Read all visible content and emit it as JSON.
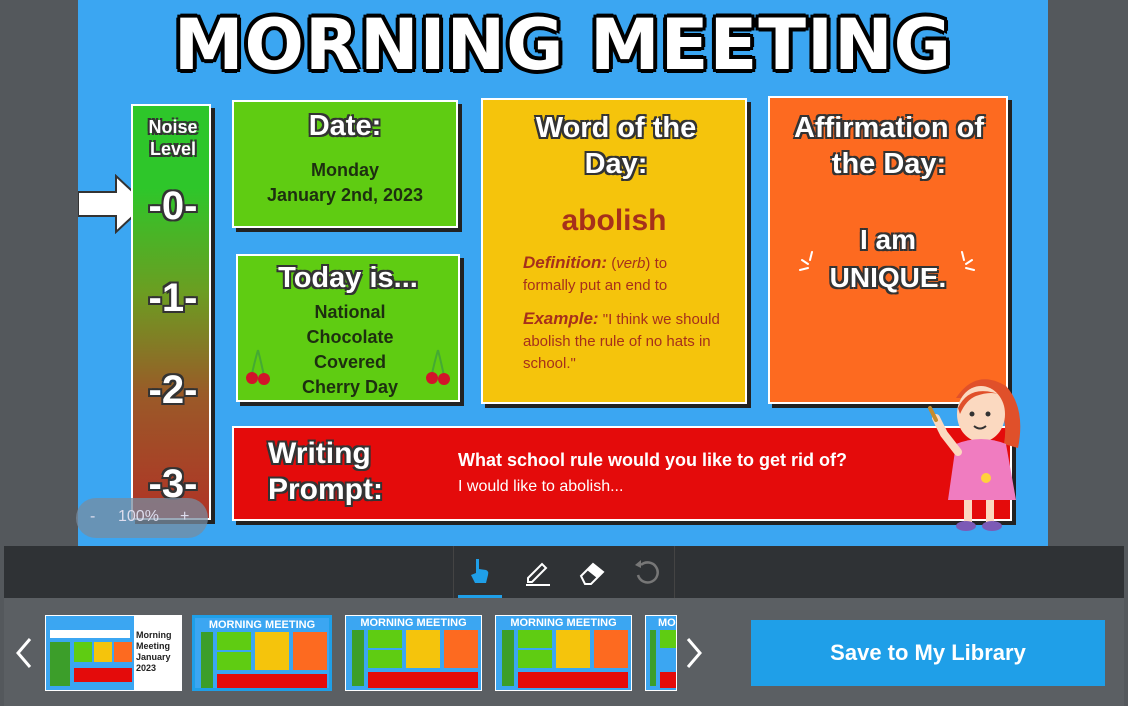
{
  "slide": {
    "title": "MORNING MEETING",
    "noise": {
      "label": "Noise Level",
      "levels": [
        "-0-",
        "-1-",
        "-2-",
        "-3-"
      ]
    },
    "date": {
      "title": "Date:",
      "day": "Monday",
      "full": "January 2nd, 2023"
    },
    "today": {
      "title": "Today is...",
      "text": "National Chocolate Covered Cherry Day"
    },
    "word": {
      "title": "Word of the Day:",
      "word": "abolish",
      "definition_label": "Definition:",
      "definition_pos": "verb",
      "definition": "to formally put an end to",
      "example_label": "Example:",
      "example": "\"I think we should abolish the rule of no hats in school.\""
    },
    "affirmation": {
      "title": "Affirmation of the Day:",
      "line1": "I am",
      "line2": "UNIQUE."
    },
    "writing": {
      "title_line1": "Writing",
      "title_line2": "Prompt:",
      "question": "What school rule would you like to get rid of?",
      "starter": "I would like to abolish..."
    }
  },
  "zoom": {
    "minus": "-",
    "level": "100%",
    "plus": "+"
  },
  "tools": {
    "icons": [
      "pointer-hand-icon",
      "pen-icon",
      "eraser-icon",
      "undo-icon"
    ]
  },
  "thumbnails": [
    {
      "title": "Morning Meeting January 2023",
      "label": "Morning Meeting January 2023"
    },
    {
      "title": "MORNING MEETING"
    },
    {
      "title": "MORNING MEETING"
    },
    {
      "title": "MORNING MEETING"
    },
    {
      "title": "MO"
    }
  ],
  "save_button": "Save to My Library",
  "colors": {
    "slide_bg": "#3ba6f2",
    "green_card": "#5fcc12",
    "yellow_card": "#f5c40c",
    "orange_card": "#fd6a20",
    "red_card": "#e40b0b",
    "save_button": "#1f9fe8"
  }
}
